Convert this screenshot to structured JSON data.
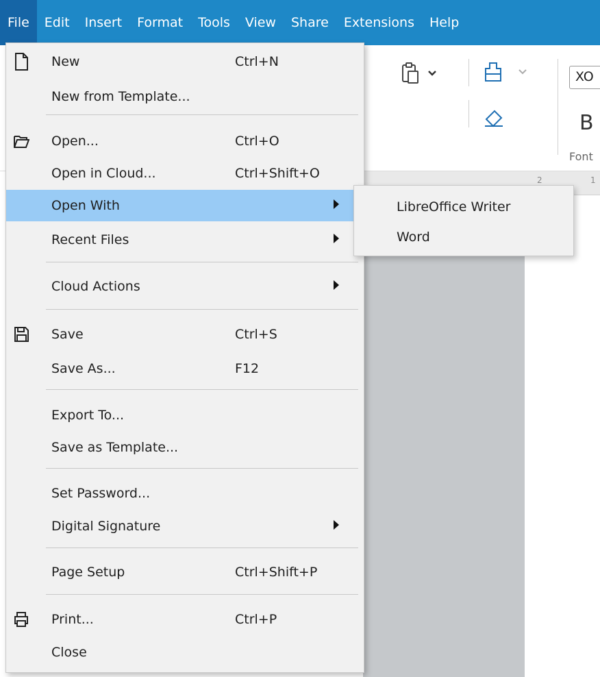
{
  "menubar": {
    "items": [
      "File",
      "Edit",
      "Insert",
      "Format",
      "Tools",
      "View",
      "Share",
      "Extensions",
      "Help"
    ]
  },
  "toolbar": {
    "font_name": "XO",
    "bold_label": "B",
    "font_group_label": "Font"
  },
  "ruler": {
    "marks": [
      "2",
      "1"
    ]
  },
  "file_menu": {
    "new": {
      "label": "New",
      "shortcut": "Ctrl+N"
    },
    "new_from_template": {
      "label": "New from Template..."
    },
    "open": {
      "label": "Open...",
      "shortcut": "Ctrl+O"
    },
    "open_in_cloud": {
      "label": "Open in Cloud...",
      "shortcut": "Ctrl+Shift+O"
    },
    "open_with": {
      "label": "Open With"
    },
    "recent_files": {
      "label": "Recent Files"
    },
    "cloud_actions": {
      "label": "Cloud Actions"
    },
    "save": {
      "label": "Save",
      "shortcut": "Ctrl+S"
    },
    "save_as": {
      "label": "Save As...",
      "shortcut": "F12"
    },
    "export_to": {
      "label": "Export To..."
    },
    "save_as_template": {
      "label": "Save as Template..."
    },
    "set_password": {
      "label": "Set Password..."
    },
    "digital_signature": {
      "label": "Digital Signature"
    },
    "page_setup": {
      "label": "Page Setup",
      "shortcut": "Ctrl+Shift+P"
    },
    "print": {
      "label": "Print...",
      "shortcut": "Ctrl+P"
    },
    "close": {
      "label": "Close"
    }
  },
  "open_with_submenu": {
    "items": [
      "LibreOffice Writer",
      "Word"
    ]
  },
  "colors": {
    "menubar_bg": "#1e88c7",
    "menubar_active": "#1565a6",
    "highlight": "#99cbf5",
    "menu_bg": "#f1f1f1"
  }
}
